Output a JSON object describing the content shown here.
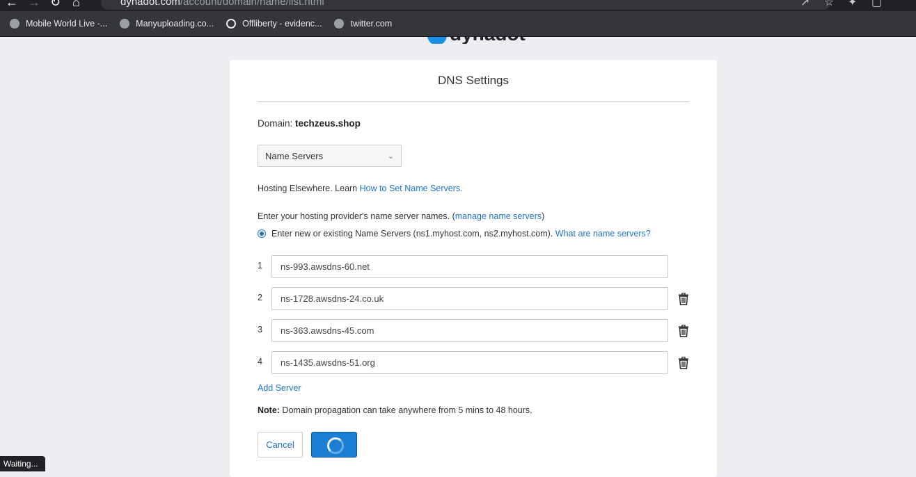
{
  "browser": {
    "url_host": "dynadot.com",
    "url_path": "/account/domain/name/list.html",
    "bookmarks": [
      {
        "label": "Mobile World Live -...",
        "icon": "globe-icon"
      },
      {
        "label": "Manyuploading.co...",
        "icon": "globe-icon"
      },
      {
        "label": "Offliberty - evidenc...",
        "icon": "power-icon"
      },
      {
        "label": "twitter.com",
        "icon": "globe-icon"
      }
    ],
    "status_text": "Waiting..."
  },
  "logo": "dynadot",
  "dns": {
    "title": "DNS Settings",
    "domain_label": "Domain:",
    "domain_value": "techzeus.shop",
    "type_select": "Name Servers",
    "hosting_text": "Hosting Elsewhere. Learn ",
    "hosting_link": "How to Set Name Servers.",
    "enter_text": "Enter your hosting provider's name server names. (",
    "manage_link": "manage name servers",
    "enter_close": ")",
    "radio_text": "Enter new or existing Name Servers (ns1.myhost.com, ns2.myhost.com). ",
    "radio_link": "What are name servers?",
    "servers": [
      {
        "num": "1",
        "value": "ns-993.awsdns-60.net"
      },
      {
        "num": "2",
        "value": "ns-1728.awsdns-24.co.uk"
      },
      {
        "num": "3",
        "value": "ns-363.awsdns-45.com"
      },
      {
        "num": "4",
        "value": "ns-1435.awsdns-51.org"
      }
    ],
    "add_server": "Add Server",
    "note_label": "Note:",
    "note_text": " Domain propagation can take anywhere from 5 mins to 48 hours.",
    "cancel_label": "Cancel"
  }
}
